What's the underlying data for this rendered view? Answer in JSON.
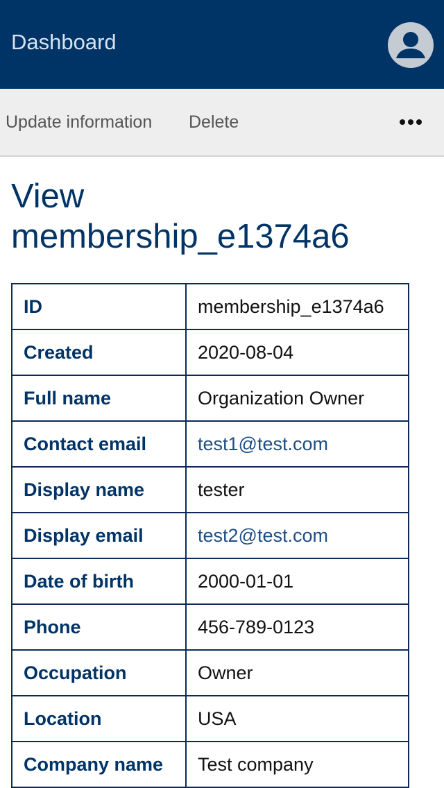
{
  "header": {
    "brand": "Dashboard",
    "avatar_icon": "user-circle-icon"
  },
  "actions": {
    "update": "Update information",
    "delete": "Delete",
    "more_icon": "more-horizontal-icon"
  },
  "page": {
    "title_line1": "View",
    "title_line2": "membership_e1374a6"
  },
  "details": {
    "rows": [
      {
        "label": "ID",
        "value": "membership_e1374a6"
      },
      {
        "label": "Created",
        "value": "2020-08-04"
      },
      {
        "label": "Full name",
        "value": "Organization Owner"
      },
      {
        "label": "Contact email",
        "value": "test1@test.com"
      },
      {
        "label": "Display name",
        "value": "tester"
      },
      {
        "label": "Display email",
        "value": "test2@test.com"
      },
      {
        "label": "Date of birth",
        "value": "2000-01-01"
      },
      {
        "label": "Phone",
        "value": "456-789-0123"
      },
      {
        "label": "Occupation",
        "value": "Owner"
      },
      {
        "label": "Location",
        "value": "USA"
      },
      {
        "label": "Company name",
        "value": "Test company"
      }
    ]
  },
  "colors": {
    "primary": "#003366",
    "link": "#1f4e85",
    "toolbar_bg": "#eeeeee"
  }
}
